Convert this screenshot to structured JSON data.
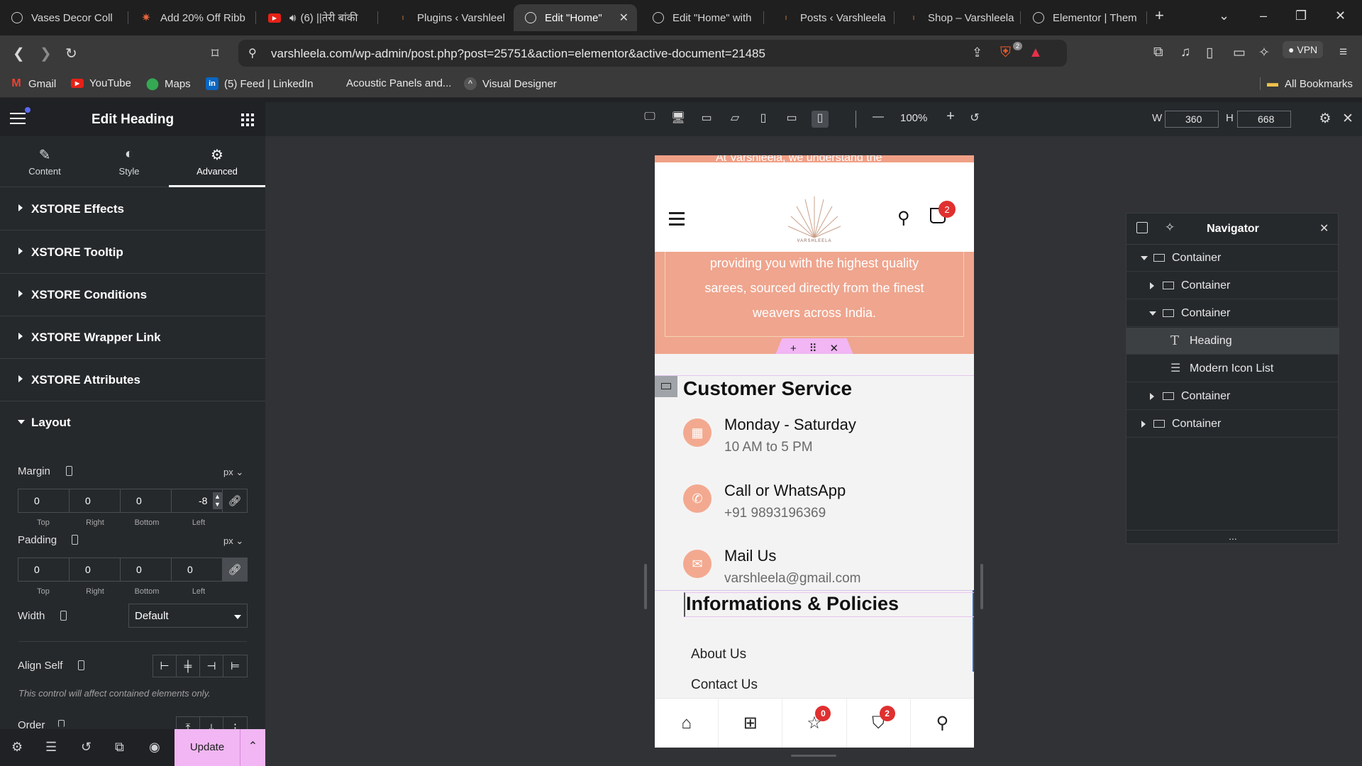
{
  "browser": {
    "tabs": [
      {
        "title": "Vases Decor Coll",
        "icon": "globe-icon",
        "active": false
      },
      {
        "title": "Add 20% Off Ribb",
        "icon": "starburst-icon",
        "active": false
      },
      {
        "title": "(6) ||तेरी बांकी",
        "icon": "youtube-icon",
        "active": false
      },
      {
        "title": "Plugins ‹ Varshleel",
        "icon": "feather-icon",
        "active": false
      },
      {
        "title": "Edit \"Home\"",
        "icon": "globe-icon",
        "active": true
      },
      {
        "title": "Edit \"Home\" with",
        "icon": "globe-icon",
        "active": false
      },
      {
        "title": "Posts ‹ Varshleela",
        "icon": "feather-icon",
        "active": false
      },
      {
        "title": "Shop – Varshleela",
        "icon": "feather-icon",
        "active": false
      },
      {
        "title": "Elementor | Them",
        "icon": "globe-icon",
        "active": false
      }
    ],
    "url": "varshleela.com/wp-admin/post.php?post=25751&action=elementor&active-document=21485",
    "shield_badge": "2",
    "vpn_label": "VPN",
    "bookmarks": [
      {
        "label": "Gmail",
        "icon": "gmail-icon"
      },
      {
        "label": "YouTube",
        "icon": "youtube-icon"
      },
      {
        "label": "Maps",
        "icon": "maps-icon"
      },
      {
        "label": "(5) Feed | LinkedIn",
        "icon": "linkedin-icon"
      },
      {
        "label": "Acoustic Panels and...",
        "icon": "none"
      },
      {
        "label": "Visual Designer",
        "icon": "visual-designer-icon"
      }
    ],
    "all_bookmarks": "All Bookmarks"
  },
  "panel": {
    "title": "Edit Heading",
    "tabs": [
      {
        "label": "Content",
        "icon": "pencil-icon"
      },
      {
        "label": "Style",
        "icon": "contrast-icon"
      },
      {
        "label": "Advanced",
        "icon": "gear-icon"
      }
    ],
    "active_tab": "Advanced",
    "sections": [
      "XSTORE Effects",
      "XSTORE Tooltip",
      "XSTORE Conditions",
      "XSTORE Wrapper Link",
      "XSTORE Attributes"
    ],
    "layout": {
      "title": "Layout",
      "margin": {
        "label": "Margin",
        "unit": "px",
        "values": [
          "0",
          "0",
          "0",
          "-8"
        ],
        "sides": [
          "Top",
          "Right",
          "Bottom",
          "Left"
        ]
      },
      "padding": {
        "label": "Padding",
        "unit": "px",
        "values": [
          "0",
          "0",
          "0",
          "0"
        ],
        "sides": [
          "Top",
          "Right",
          "Bottom",
          "Left"
        ]
      },
      "width": {
        "label": "Width",
        "value": "Default"
      },
      "align_self": {
        "label": "Align Self"
      },
      "hint": "This control will affect contained elements only.",
      "order": {
        "label": "Order"
      }
    },
    "footer": {
      "update_label": "Update"
    }
  },
  "editor": {
    "zoom": "100%",
    "width_label": "W",
    "width_value": "360",
    "height_label": "H",
    "height_value": "668"
  },
  "preview": {
    "top_strip_text": "At Varshleela, we understand the",
    "brand_logo_text": "VARSHLEELA",
    "cart_badge": "2",
    "peach_lines": [
      "providing you with the highest quality",
      "sarees, sourced directly from the finest",
      "weavers across India."
    ],
    "customer_service": {
      "title": "Customer Service",
      "items": [
        {
          "icon": "calendar-icon",
          "head": "Monday - Saturday",
          "sub": "10 AM to 5 PM"
        },
        {
          "icon": "phone-icon",
          "head": "Call or WhatsApp",
          "sub": "+91 9893196369"
        },
        {
          "icon": "mail-icon",
          "head": "Mail Us",
          "sub": "varshleela@gmail.com"
        }
      ]
    },
    "info": {
      "title": "Informations & Policies",
      "links": [
        "About Us",
        "Contact Us"
      ]
    },
    "bottom_nav": {
      "wishlist_badge": "0",
      "cart_badge": "2"
    }
  },
  "navigator": {
    "title": "Navigator",
    "rows": [
      {
        "label": "Container",
        "depth": 0,
        "caret": "down",
        "icon": "container-icon"
      },
      {
        "label": "Container",
        "depth": 1,
        "caret": "right",
        "icon": "container-icon"
      },
      {
        "label": "Container",
        "depth": 1,
        "caret": "down",
        "icon": "container-icon"
      },
      {
        "label": "Heading",
        "depth": 2,
        "caret": "none",
        "icon": "heading-icon",
        "selected": true
      },
      {
        "label": "Modern Icon List",
        "depth": 2,
        "caret": "none",
        "icon": "list-icon"
      },
      {
        "label": "Container",
        "depth": 1,
        "caret": "right",
        "icon": "container-icon"
      },
      {
        "label": "Container",
        "depth": 0,
        "caret": "right",
        "icon": "container-icon"
      }
    ],
    "more": "..."
  }
}
